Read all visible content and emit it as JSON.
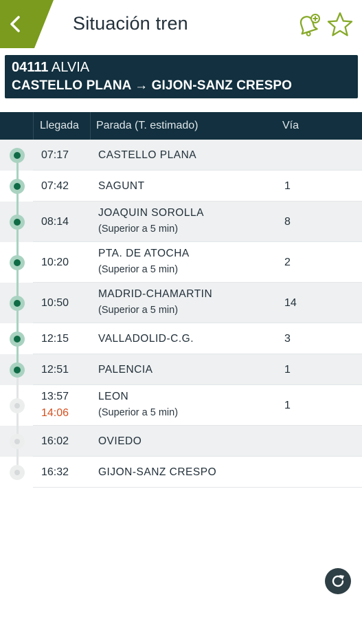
{
  "header": {
    "title": "Situación tren",
    "accent_color": "#7a9b1d"
  },
  "train": {
    "number": "04111",
    "type": "ALVIA",
    "route": "CASTELLO PLANA → GIJON-SANZ CRESPO"
  },
  "table": {
    "columns": {
      "arrival": "Llegada",
      "stop": "Parada (T. estimado)",
      "track": "Vía"
    },
    "rows": [
      {
        "time": "07:17",
        "stop": "CASTELLO PLANA",
        "note": "",
        "track": "",
        "late": ""
      },
      {
        "time": "07:42",
        "stop": "SAGUNT",
        "note": "",
        "track": "1",
        "late": ""
      },
      {
        "time": "08:14",
        "stop": "JOAQUIN SOROLLA",
        "note": "(Superior a 5 min)",
        "track": "8",
        "late": ""
      },
      {
        "time": "10:20",
        "stop": "PTA. DE ATOCHA",
        "note": "(Superior a 5 min)",
        "track": "2",
        "late": ""
      },
      {
        "time": "10:50",
        "stop": "MADRID-CHAMARTIN",
        "note": "(Superior a 5 min)",
        "track": "14",
        "late": ""
      },
      {
        "time": "12:15",
        "stop": "VALLADOLID-C.G.",
        "note": "",
        "track": "3",
        "late": ""
      },
      {
        "time": "12:51",
        "stop": "PALENCIA",
        "note": "",
        "track": "1",
        "late": ""
      },
      {
        "time": "13:57",
        "stop": "LEON",
        "note": "(Superior a 5 min)",
        "track": "1",
        "late": "14:06"
      },
      {
        "time": "16:02",
        "stop": "OVIEDO",
        "note": "",
        "track": "",
        "late": ""
      },
      {
        "time": "16:32",
        "stop": "GIJON-SANZ CRESPO",
        "note": "",
        "track": "",
        "late": ""
      }
    ]
  },
  "icons": {
    "back": "chevron-left-icon",
    "alert": "bell-add-icon",
    "favorite": "star-outline-icon",
    "refresh": "refresh-icon"
  }
}
